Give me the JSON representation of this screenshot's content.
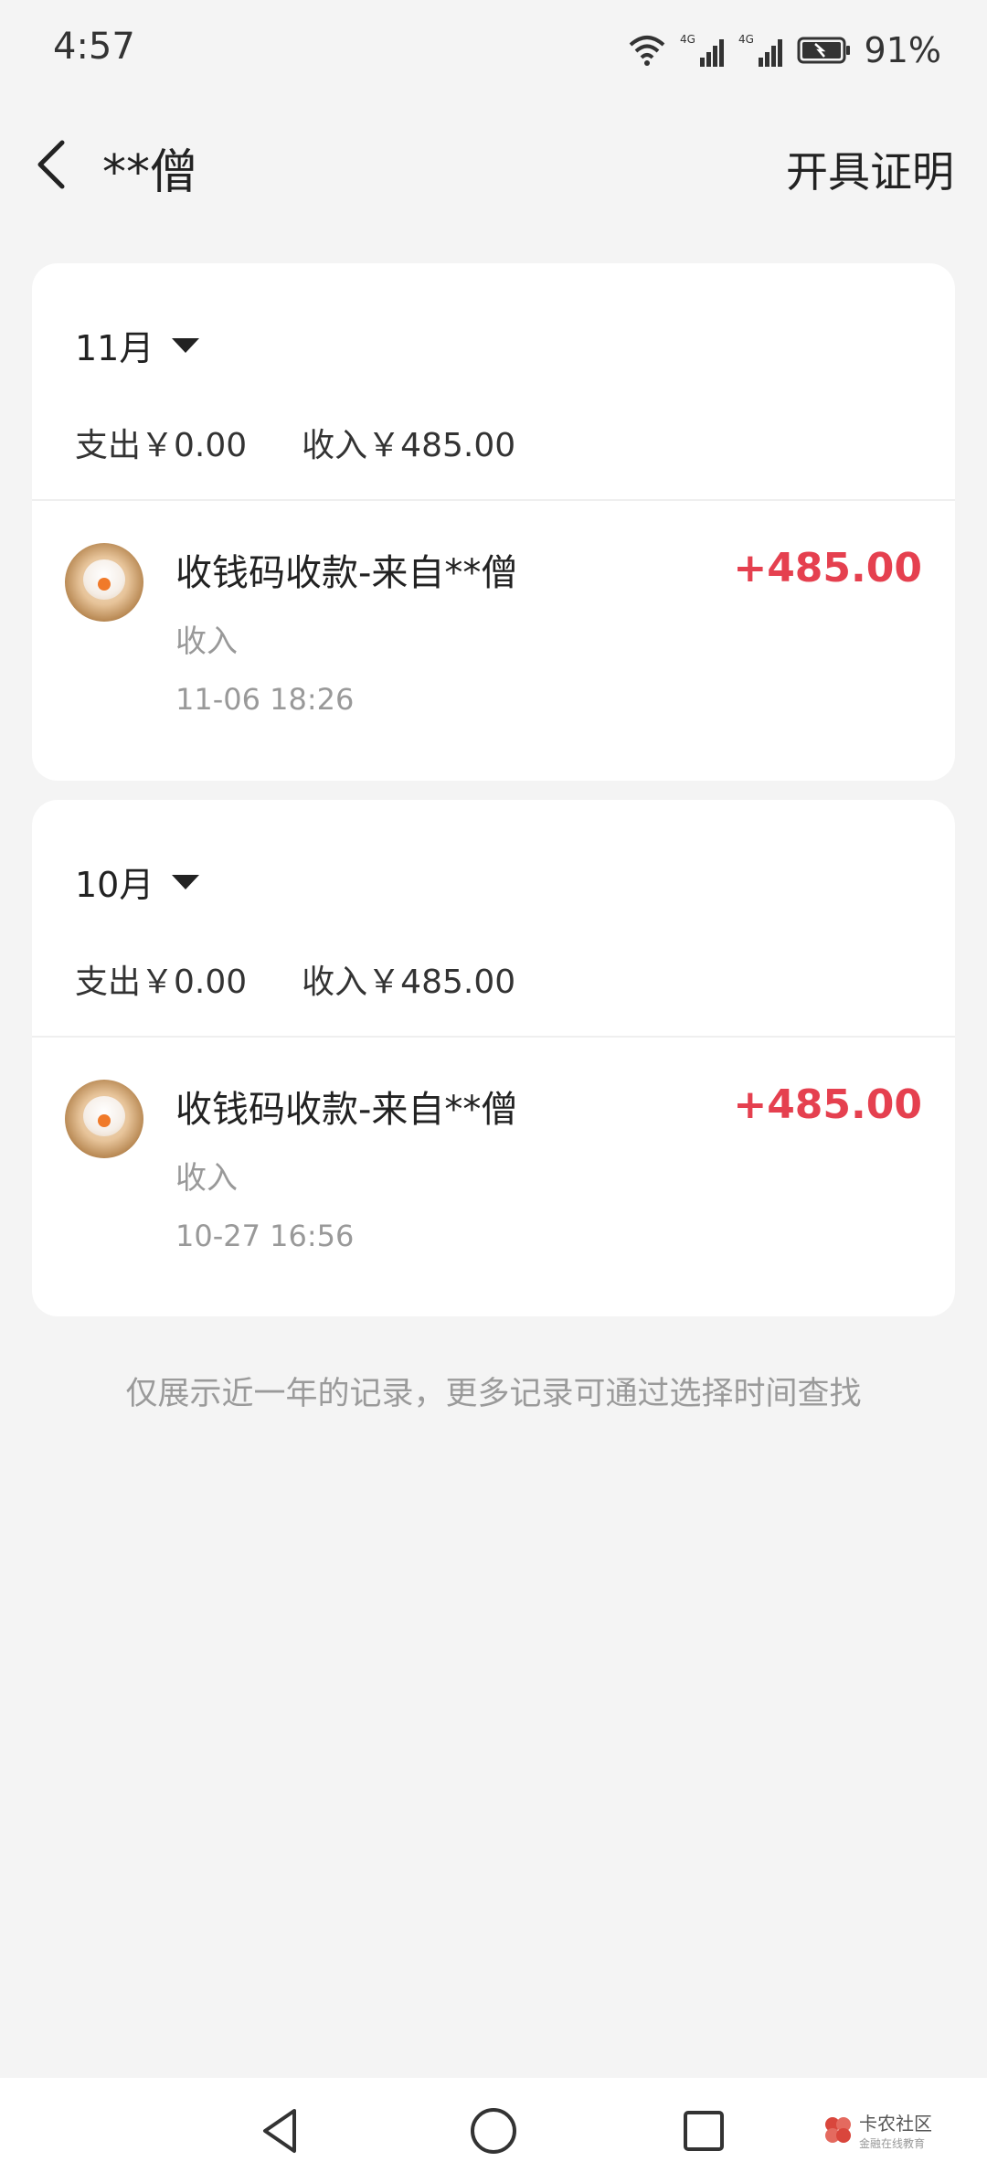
{
  "status_bar": {
    "time": "4:57",
    "battery": "91%",
    "network_1": "4G",
    "network_2": "4G"
  },
  "header": {
    "title": "**僧",
    "action": "开具证明"
  },
  "months": [
    {
      "label": "11月",
      "summary": {
        "expense": "支出￥0.00",
        "income": "收入￥485.00"
      },
      "transactions": [
        {
          "title": "收钱码收款-来自**僧",
          "type": "收入",
          "time": "11-06 18:26",
          "amount": "+485.00"
        }
      ]
    },
    {
      "label": "10月",
      "summary": {
        "expense": "支出￥0.00",
        "income": "收入￥485.00"
      },
      "transactions": [
        {
          "title": "收钱码收款-来自**僧",
          "type": "收入",
          "time": "10-27 16:56",
          "amount": "+485.00"
        }
      ]
    }
  ],
  "footnote": "仅展示近一年的记录，更多记录可通过选择时间查找",
  "watermark": {
    "main": "卡农社区",
    "sub": "金融在线教育"
  },
  "colors": {
    "amount": "#e5404f",
    "background": "#f4f4f4",
    "card": "#ffffff"
  }
}
